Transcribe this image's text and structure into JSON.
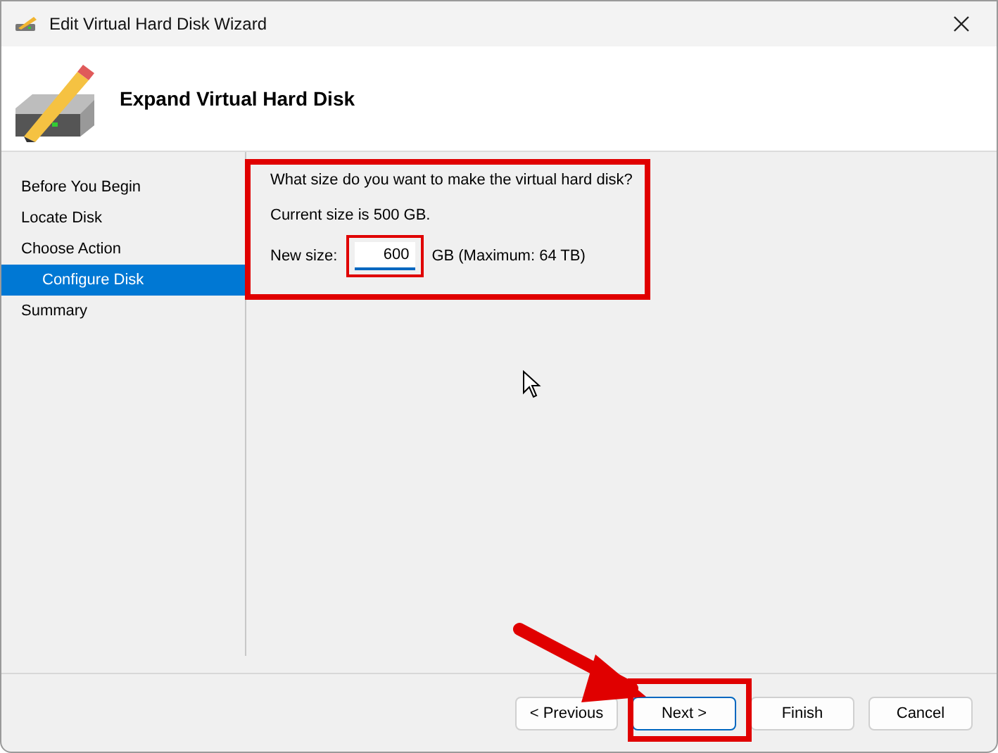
{
  "window": {
    "title": "Edit Virtual Hard Disk Wizard"
  },
  "header": {
    "title": "Expand Virtual Hard Disk"
  },
  "steps": [
    {
      "label": "Before You Begin",
      "selected": false
    },
    {
      "label": "Locate Disk",
      "selected": false
    },
    {
      "label": "Choose Action",
      "selected": false,
      "children": [
        {
          "label": "Configure Disk",
          "selected": true
        }
      ]
    },
    {
      "label": "Summary",
      "selected": false
    }
  ],
  "form": {
    "question": "What size do you want to make the virtual hard disk?",
    "current_size": "Current size is 500 GB.",
    "new_size_label": "New size:",
    "new_size_value": "600",
    "unit_note": "GB (Maximum: 64 TB)"
  },
  "buttons": [
    {
      "label": "< Previous",
      "focused": false
    },
    {
      "label": "Next >",
      "focused": true
    },
    {
      "label": "Finish",
      "focused": false
    },
    {
      "label": "Cancel",
      "focused": false
    }
  ]
}
